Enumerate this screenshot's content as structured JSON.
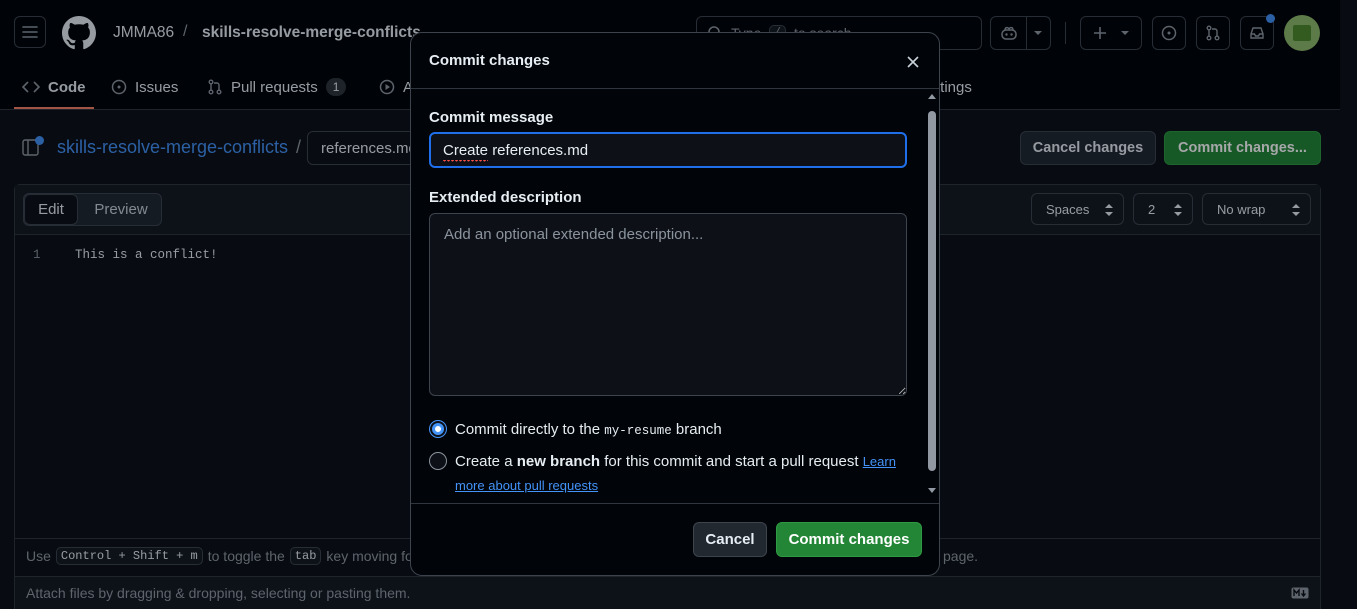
{
  "header": {
    "owner": "JMMA86",
    "separator": "/",
    "repo": "skills-resolve-merge-conflicts",
    "search_placeholder": "Type / to search",
    "search_part1": "Type",
    "search_key": "/",
    "search_part2": "to search"
  },
  "nav": {
    "code": "Code",
    "issues": "Issues",
    "pull_requests": "Pull requests",
    "pull_requests_count": "1",
    "actions_partial": "A",
    "settings_partial": "ttings"
  },
  "editor": {
    "repo_link": "skills-resolve-merge-conflicts",
    "path_sep": "/",
    "filename": "references.md",
    "cancel_label": "Cancel changes",
    "commit_label": "Commit changes...",
    "tab_edit": "Edit",
    "tab_preview": "Preview",
    "indent_mode": "Spaces",
    "indent_size": "2",
    "wrap_mode": "No wrap",
    "line_number": "1",
    "line_text": "This is a conflict!",
    "hint_use": "Use",
    "hint_kbd1": "Control + Shift + m",
    "hint_toggle": "to toggle the",
    "hint_kbd2": "tab",
    "hint_rest": "key moving foc",
    "hint_end": "page.",
    "attach_text": "Attach files by dragging & dropping, selecting or pasting them."
  },
  "modal": {
    "title": "Commit changes",
    "message_label": "Commit message",
    "message_value": "Create references.md",
    "description_label": "Extended description",
    "description_placeholder": "Add an optional extended description...",
    "option1_prefix": "Commit directly to the",
    "option1_branch": "my-resume",
    "option1_suffix": "branch",
    "option2_prefix": "Create a",
    "option2_bold": "new branch",
    "option2_suffix": "for this commit and start a pull request",
    "option2_link1": "Learn",
    "option2_link2": "more about pull requests",
    "cancel_label": "Cancel",
    "commit_label": "Commit changes"
  },
  "colors": {
    "accent": "#1f6feb",
    "primary_button": "#238636",
    "link": "#4493f8",
    "background": "#0d1117"
  }
}
